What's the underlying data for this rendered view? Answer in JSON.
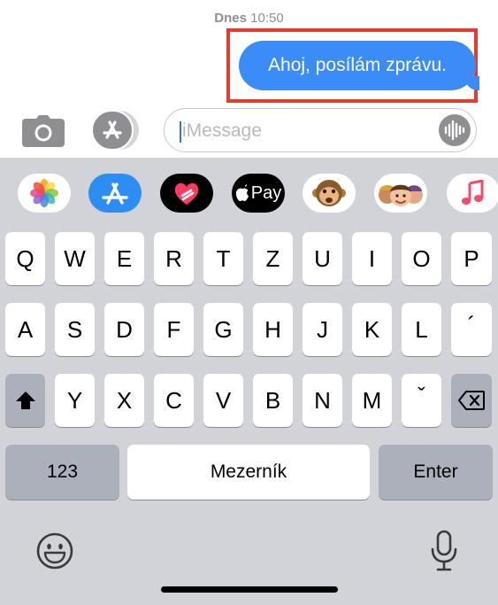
{
  "chat": {
    "timestamp_day": "Dnes",
    "timestamp_time": "10:50",
    "sent_message": "Ahoj, posílám zprávu."
  },
  "composer": {
    "placeholder": "iMessage"
  },
  "app_strip": {
    "items": [
      "photos-icon",
      "app-store-icon",
      "digital-touch-icon",
      "apple-pay-icon",
      "animoji-monkey-icon",
      "memoji-icon",
      "music-icon"
    ],
    "apple_pay_label": "Pay"
  },
  "keyboard": {
    "row1": [
      "Q",
      "W",
      "E",
      "R",
      "T",
      "Z",
      "U",
      "I",
      "O",
      "P"
    ],
    "row2": [
      "A",
      "S",
      "D",
      "F",
      "G",
      "H",
      "J",
      "K",
      "L",
      "´"
    ],
    "row3": [
      "Y",
      "X",
      "C",
      "V",
      "B",
      "N",
      "M",
      "ˇ"
    ],
    "numbers_label": "123",
    "space_label": "Mezerník",
    "enter_label": "Enter"
  },
  "colors": {
    "bubble": "#3b8cf6",
    "highlight_frame": "#e53b2f",
    "keyboard_bg": "#d1d3d9",
    "key_dark": "#abb0ba"
  }
}
